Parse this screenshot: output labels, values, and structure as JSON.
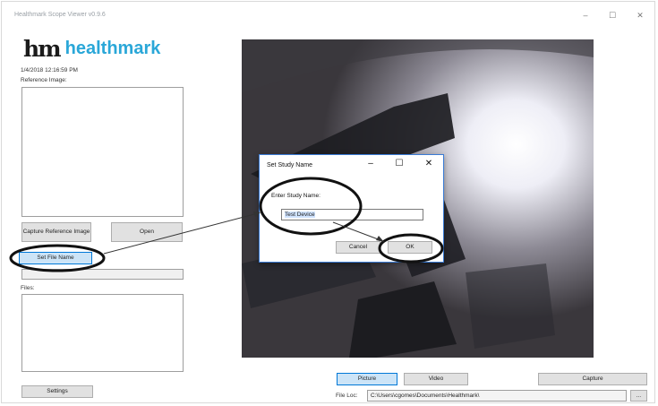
{
  "window": {
    "title": "Healthmark Scope Viewer v0.9.6",
    "controls": {
      "minimize": "–",
      "maximize": "☐",
      "close": "✕"
    }
  },
  "brand": {
    "mark": "hm",
    "name": "healthmark",
    "accent": "#2aa7d8"
  },
  "left_panel": {
    "timestamp": "1/4/2018 12:16:59 PM",
    "reference_label": "Reference Image:",
    "capture_ref_button": "Capture Reference Image",
    "open_button": "Open",
    "set_file_name_button": "Set File Name",
    "files_label": "Files:",
    "settings_button": "Settings"
  },
  "bottom_bar": {
    "picture_button": "Picture",
    "video_button": "Video",
    "capture_button": "Capture",
    "file_loc_label": "File Loc:",
    "file_loc_value": "C:\\Users\\cgomes\\Documents\\Healthmark\\",
    "browse_button": "..."
  },
  "dialog": {
    "title": "Set Study Name",
    "controls": {
      "minimize": "–",
      "maximize": "☐",
      "close": "✕"
    },
    "prompt_label": "Enter Study Name:",
    "input_value": "Test Device",
    "cancel_button": "Cancel",
    "ok_button": "OK"
  },
  "colors": {
    "annotation": "#111111",
    "selected_button": "#cce4f7",
    "button_face": "#e1e1e1"
  }
}
